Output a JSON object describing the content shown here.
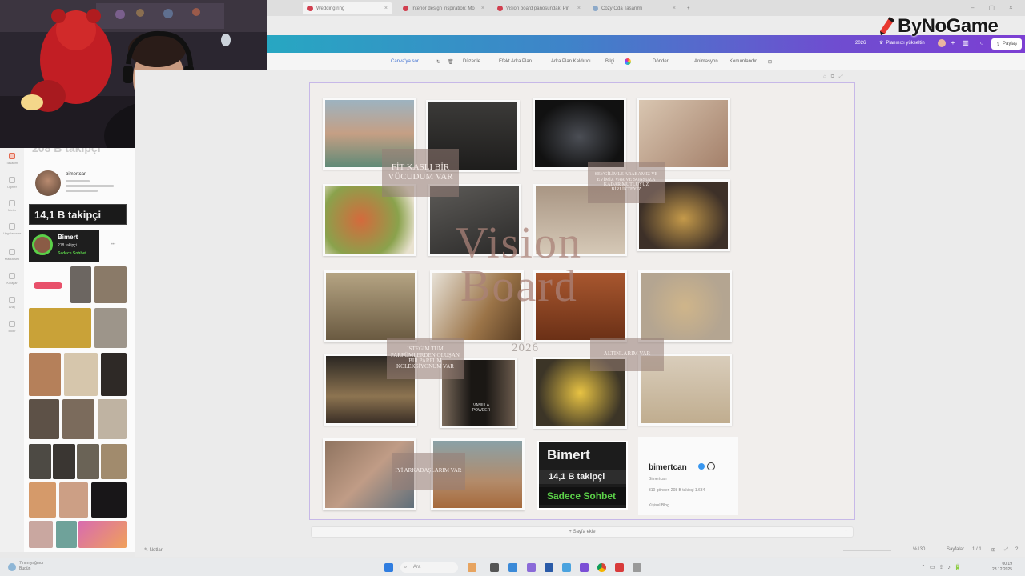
{
  "browser": {
    "tabs": [
      {
        "label": "Wedding ring"
      },
      {
        "label": "Interior design inspiration: Mo"
      },
      {
        "label": "Vision board panosundaki Pin"
      },
      {
        "label": "Cozy Oda Tasarımı"
      }
    ],
    "new_tab": "+"
  },
  "watermark": {
    "text": "ByNoGame"
  },
  "editor_header": {
    "year": "2026",
    "plan_label": "Planınızı yükseltin",
    "share_label": "Paylaş"
  },
  "toolbar": {
    "items": [
      "Canva'ya sor",
      "Düzenle",
      "Efekt Arka Plan",
      "Arka Plan Kaldırıcı",
      "Bilgi",
      "Dönder",
      "Animasyon",
      "Konumlandır"
    ]
  },
  "sidebar": {
    "rail": [
      "Tasarım",
      "Öğeler",
      "Metin",
      "Uygulamalar",
      "Marka seti",
      "Kolajlar",
      "Araç",
      "Ekler"
    ],
    "top_text": "208 B takipçi",
    "profile_name": "bimertcan",
    "followers_badge": "14,1 B takipçi",
    "chat_card": {
      "name": "Bimert",
      "followers": "218 takipçi",
      "status": "Sadece Sohbet"
    }
  },
  "board": {
    "title_line1": "Vision",
    "title_line2": "Board",
    "year": "2026",
    "labels": {
      "fit_body": "FİT KASLI BİR VÜCUDUM VAR",
      "car_love": "SEVGİLİMLE ARABAMIZ VE EVİMİZ VAR VE SONSUZA KADAR MUTLUYUZ BİRLİKTEYİZ",
      "perfume": "İSTEĞİM TÜM PARFÜMLERDEN OLUŞAN BİR PARFÜM KOLEKSİYONUM VAR",
      "gold": "ALTINLARIM VAR",
      "friends": "İYİ ARKADAŞLARIM VAR"
    },
    "bimert_card": {
      "name": "Bimert",
      "followers": "14,1 B takipçi",
      "status": "Sadece Sohbet"
    },
    "ig_card": {
      "username": "bimertcan",
      "display": "Bimertcan",
      "stats": "310 gönderi   208 B takipçi   1.634",
      "subtitle": "Kişisel Blog"
    },
    "vanilla_text": "VANILLA POWDER"
  },
  "add_page_label": "+ Sayfa ekle",
  "footer": {
    "notes": "Notlar",
    "zoom": "%130",
    "pages_label": "Sayfalar",
    "page_count": "1 / 1"
  },
  "taskbar": {
    "weather_line1": "7 mm yağmur",
    "weather_line2": "Bugün",
    "search_placeholder": "Ara",
    "time": "00:19",
    "date": "28.12.2025"
  }
}
